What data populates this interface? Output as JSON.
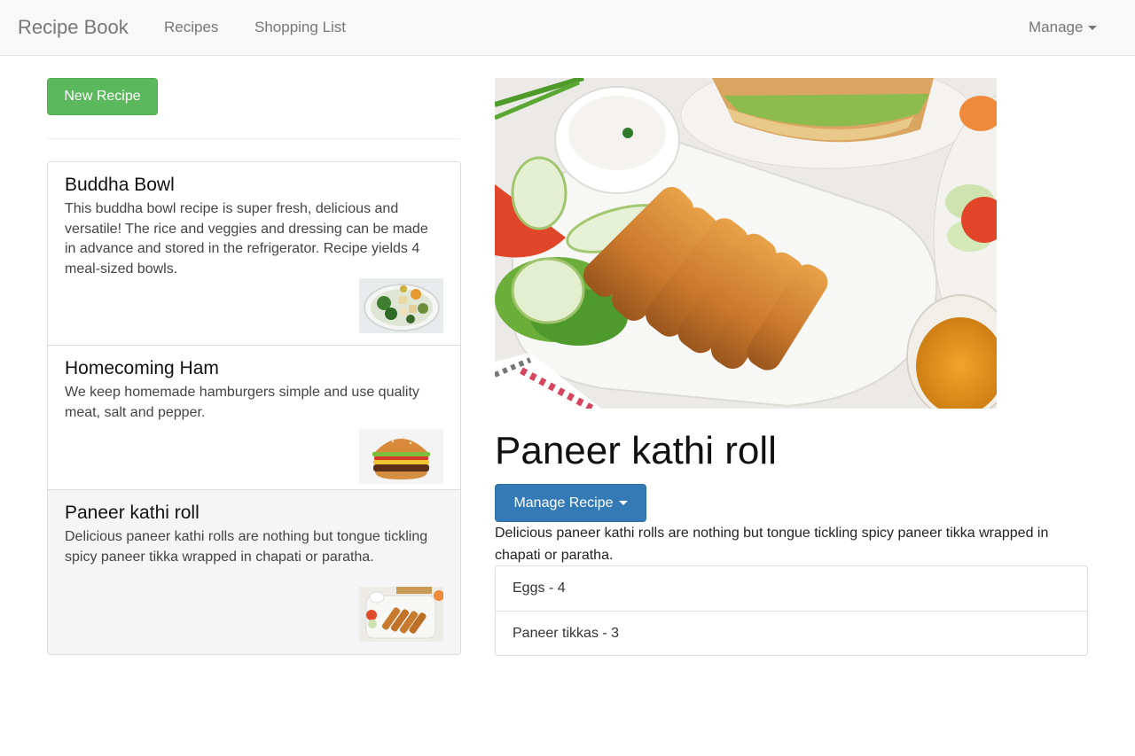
{
  "navbar": {
    "brand": "Recipe Book",
    "links": [
      "Recipes",
      "Shopping List"
    ],
    "manage_label": "Manage"
  },
  "left": {
    "new_recipe_label": "New Recipe",
    "recipes": [
      {
        "title": "Buddha Bowl",
        "description": "This buddha bowl recipe is super fresh, delicious and versatile! The rice and veggies and dressing can be made in advance and stored in the refrigerator. Recipe yields 4 meal-sized bowls."
      },
      {
        "title": "Homecoming Ham",
        "description": "We keep homemade hamburgers simple and use quality meat, salt and pepper."
      },
      {
        "title": "Paneer kathi roll",
        "description": "Delicious paneer kathi rolls are nothing but tongue tickling spicy paneer tikka wrapped in chapati or paratha."
      }
    ]
  },
  "detail": {
    "title": "Paneer kathi roll",
    "manage_recipe_label": "Manage Recipe",
    "description": "Delicious paneer kathi rolls are nothing but tongue tickling spicy paneer tikka wrapped in chapati or paratha.",
    "ingredients": [
      "Eggs - 4",
      "Paneer tikkas - 3"
    ]
  },
  "colors": {
    "success": "#5cb85c",
    "primary": "#337ab7",
    "navbar_bg": "#f8f8f8"
  }
}
